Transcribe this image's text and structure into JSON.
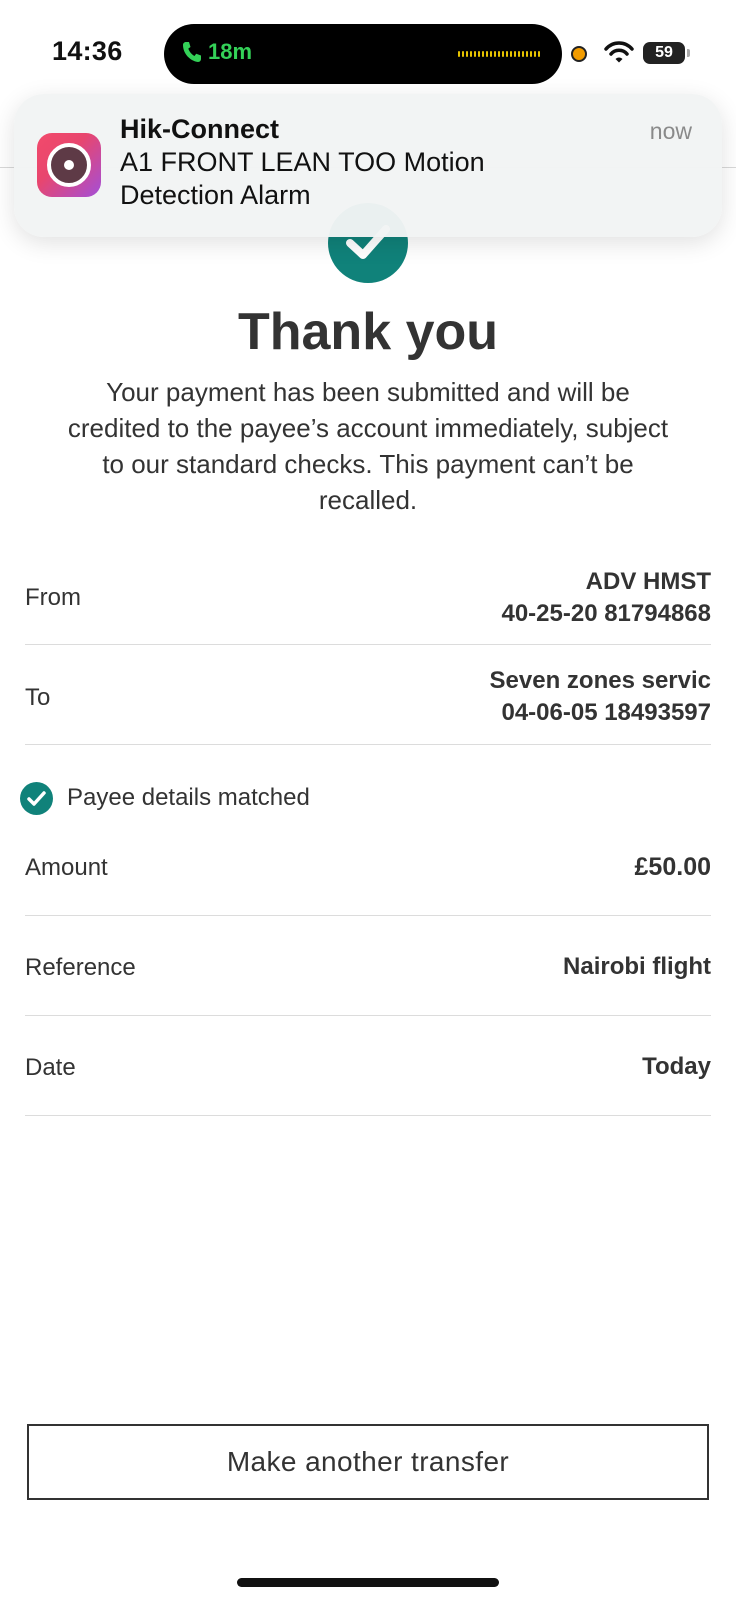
{
  "status_bar": {
    "time": "14:36",
    "call_duration": "18m",
    "battery": "59"
  },
  "notification": {
    "app_name": "Hik-Connect",
    "time": "now",
    "message": " A1 FRONT LEAN TOO Motion\nDetection Alarm"
  },
  "confirmation": {
    "title": "Thank you",
    "message": "Your payment has been submitted and will be credited to the payee’s account immediately, subject to our standard checks. This payment can’t be recalled."
  },
  "details": {
    "from": {
      "label": "From",
      "name": "ADV HMST",
      "account": "40-25-20 81794868"
    },
    "to": {
      "label": "To",
      "name": "Seven zones servic",
      "account": "04-06-05 18493597"
    },
    "payee_match": "Payee details matched",
    "amount": {
      "label": "Amount",
      "value": "£50.00"
    },
    "reference": {
      "label": "Reference",
      "value": "Nairobi flight"
    },
    "date": {
      "label": "Date",
      "value": "Today"
    }
  },
  "actions": {
    "make_another_transfer": "Make another transfer"
  },
  "colors": {
    "accent": "#10827a",
    "text": "#333333"
  }
}
